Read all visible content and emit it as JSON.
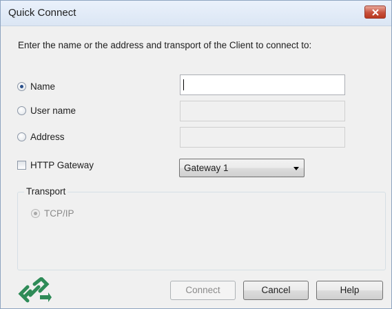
{
  "window": {
    "title": "Quick Connect"
  },
  "instruction": "Enter the name or the address and transport of the Client to connect to:",
  "options": {
    "name": {
      "label": "Name",
      "checked": true,
      "value": ""
    },
    "user_name": {
      "label": "User name",
      "checked": false,
      "value": ""
    },
    "address": {
      "label": "Address",
      "checked": false,
      "value": ""
    }
  },
  "gateway": {
    "label": "HTTP Gateway",
    "checked": false,
    "selected": "Gateway 1"
  },
  "transport": {
    "label": "Transport",
    "option_label": "TCP/IP",
    "checked": true
  },
  "buttons": {
    "connect": "Connect",
    "cancel": "Cancel",
    "help": "Help"
  },
  "icons": {
    "close": "close-icon",
    "logo": "link-logo-icon",
    "dropdown": "chevron-down-icon"
  },
  "colors": {
    "close_button": "#c7503c",
    "logo_green": "#2e8b57",
    "window_bg": "#f0f0f0"
  }
}
